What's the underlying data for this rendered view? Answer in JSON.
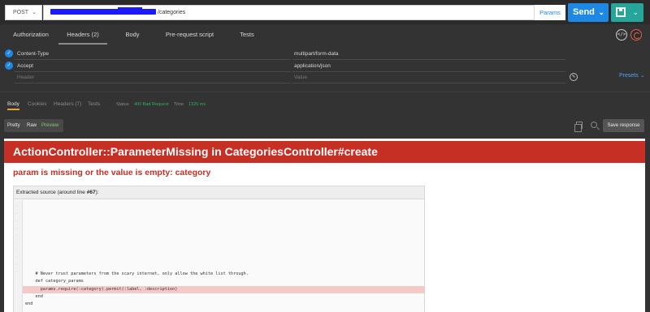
{
  "request": {
    "method": "POST",
    "url_suffix": "/categories",
    "params_label": "Params",
    "send_label": "Send"
  },
  "request_tabs": [
    {
      "label": "Authorization"
    },
    {
      "label": "Headers (2)"
    },
    {
      "label": "Body"
    },
    {
      "label": "Pre-request script"
    },
    {
      "label": "Tests"
    }
  ],
  "headers": [
    {
      "key": "Content-Type",
      "value": "multipart/form-data"
    },
    {
      "key": "Accept",
      "value": "application/json"
    }
  ],
  "header_placeholders": {
    "key": "Header",
    "value": "Value"
  },
  "presets_label": "Presets",
  "response_tabs": [
    {
      "label": "Body"
    },
    {
      "label": "Cookies"
    },
    {
      "label": "Headers (7)"
    },
    {
      "label": "Tests"
    }
  ],
  "status": {
    "label": "Status",
    "value": "400 Bad Request",
    "time_label": "Time",
    "time_value": "1325 ms"
  },
  "format_buttons": [
    {
      "label": "Pretty"
    },
    {
      "label": "Raw"
    },
    {
      "label": "Preview"
    }
  ],
  "save_response_label": "Save response",
  "preview": {
    "error_title": "ActionController::ParameterMissing in CategoriesController#create",
    "error_message": "param is missing or the value is empty: category",
    "source_title_prefix": "Extracted source (around line ",
    "source_title_line": "#67",
    "source_title_suffix": "):",
    "code_lines": [
      "    # Never trust parameters from the scary internet, only allow the white list through.",
      "    def category_params",
      "      params.require(:category).permit(:label, :description)",
      "    end",
      "end"
    ]
  },
  "colors": {
    "accent_blue": "#1e88e5",
    "save_green": "#26a69a",
    "error_red": "#c52f24",
    "status_green": "#2eae5f",
    "tab_underline": "#e8a33c"
  }
}
